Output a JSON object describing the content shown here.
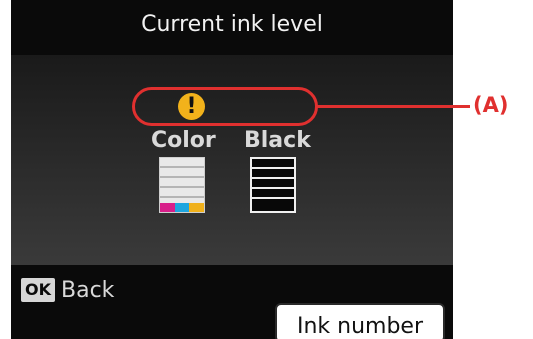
{
  "screen": {
    "title": "Current ink level",
    "warning_icon": "exclamation-warning-icon",
    "warning_glyph": "!"
  },
  "inks": [
    {
      "label": "Color",
      "colors": [
        "#d81f8a",
        "#1ea6df",
        "#f0b11c"
      ]
    },
    {
      "label": "Black"
    }
  ],
  "footer": {
    "ok_key": "OK",
    "back_label": "Back",
    "ink_number_label": "Ink number"
  },
  "annotation": {
    "label": "(A)",
    "accent_color": "#e0302f"
  }
}
